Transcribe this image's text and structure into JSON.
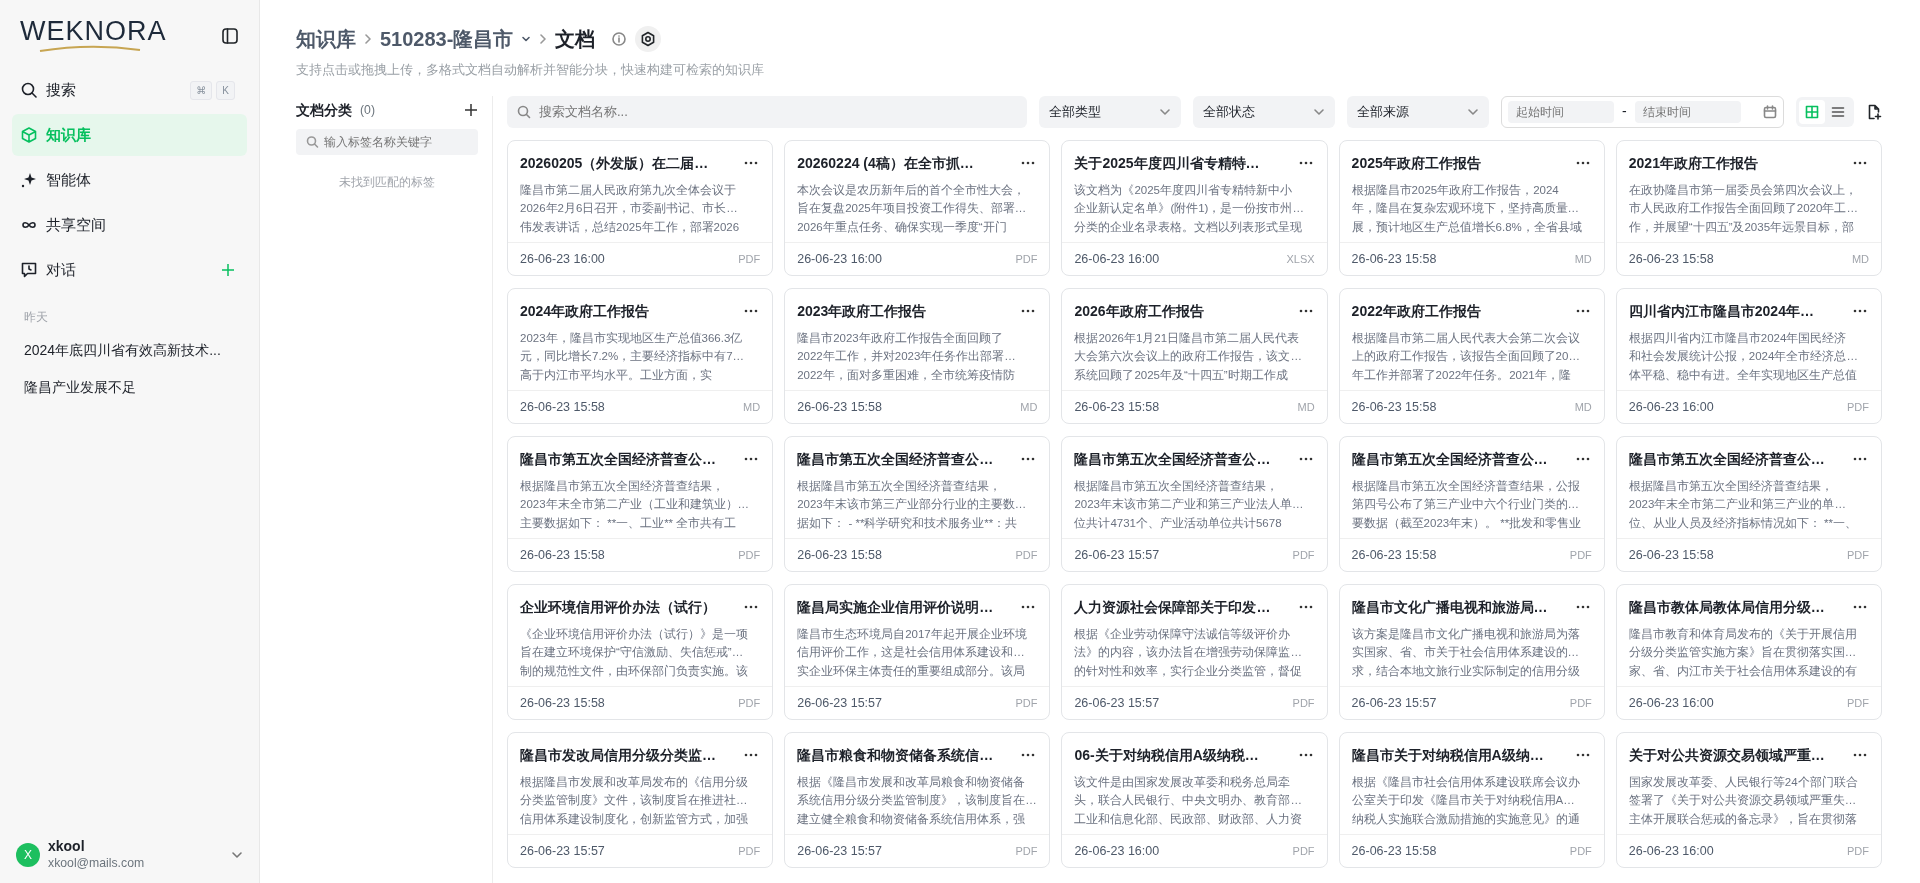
{
  "sidebar": {
    "logo": "WEKNORA",
    "nav": [
      {
        "kind": "search",
        "label": "搜索",
        "shortcut": [
          "⌘",
          "K"
        ],
        "selected": false
      },
      {
        "kind": "knowledge",
        "label": "知识库",
        "selected": true
      },
      {
        "kind": "agent",
        "label": "智能体",
        "selected": false
      },
      {
        "kind": "shared",
        "label": "共享空间",
        "selected": false
      },
      {
        "kind": "chat",
        "label": "对话",
        "selected": false
      }
    ],
    "history_group": "昨天",
    "history": [
      "2024年底四川省有效高新技术...",
      "隆昌产业发展不足"
    ],
    "user": {
      "initial": "X",
      "name": "xkool",
      "email": "xkool@mails.com"
    }
  },
  "header": {
    "breadcrumb": [
      "知识库",
      "510283-隆昌市",
      "文档"
    ],
    "subtitle": "支持点击或拖拽上传，多格式文档自动解析并智能分块，快速构建可检索的知识库"
  },
  "tags": {
    "title": "文档分类",
    "count": "(0)",
    "placeholder": "输入标签名称关键字",
    "empty": "未找到匹配的标签"
  },
  "toolbar": {
    "search_placeholder": "搜索文档名称...",
    "filters": [
      "全部类型",
      "全部状态",
      "全部来源"
    ],
    "date_start_placeholder": "起始时间",
    "date_separator": "-",
    "date_end_placeholder": "结束时间",
    "views": [
      {
        "kind": "grid",
        "selected": true
      },
      {
        "kind": "list",
        "selected": false
      }
    ]
  },
  "documents": [
    {
      "title": "20260205（外发版）在二届…",
      "summary": [
        "隆昌市第二届人民政府第九次全体会议于",
        "2026年2月6日召开，市委副书记、市长…",
        "伟发表讲话，总结2025年工作，部署2026"
      ],
      "time": "26-06-23 16:00",
      "type": "PDF"
    },
    {
      "title": "20260224 (4稿）在全市抓…",
      "summary": [
        "本次会议是农历新年后的首个全市性大会，",
        "旨在复盘2025年项目投资工作得失、部署…",
        "2026年重点任务、确保实现一季度“开门"
      ],
      "time": "26-06-23 16:00",
      "type": "PDF"
    },
    {
      "title": "关于2025年度四川省专精特…",
      "summary": [
        "该文档为《2025年度四川省专精特新中小",
        "企业新认定名单》(附件1)，是一份按市州…",
        "分类的企业名录表格。文档以列表形式呈现"
      ],
      "time": "26-06-23 16:00",
      "type": "XLSX"
    },
    {
      "title": "2025年政府工作报告",
      "summary": [
        "根据隆昌市2025年政府工作报告，2024",
        "年，隆昌在复杂宏观环境下，坚持高质量…",
        "展，预计地区生产总值增长6.8%，全省县域"
      ],
      "time": "26-06-23 15:58",
      "type": "MD"
    },
    {
      "title": "2021年政府工作报告",
      "summary": [
        "在政协隆昌市第一届委员会第四次会议上，",
        "市人民政府工作报告全面回顾了2020年工…",
        "作，并展望“十四五”及2035年远景目标，部"
      ],
      "time": "26-06-23 15:58",
      "type": "MD"
    },
    {
      "title": "2024年政府工作报告",
      "summary": [
        "2023年，隆昌市实现地区生产总值366.3亿",
        "元，同比增长7.2%，主要经济指标中有7…",
        "高于内江市平均水平。工业方面，实"
      ],
      "time": "26-06-23 15:58",
      "type": "MD"
    },
    {
      "title": "2023年政府工作报告",
      "summary": [
        "隆昌市2023年政府工作报告全面回顾了",
        "2022年工作，并对2023年任务作出部署…",
        "2022年，面对多重困难，全市统筹疫情防"
      ],
      "time": "26-06-23 15:58",
      "type": "MD"
    },
    {
      "title": "2026年政府工作报告",
      "summary": [
        "根据2026年1月21日隆昌市第二届人民代表",
        "大会第六次会议上的政府工作报告，该文…",
        "系统回顾了2025年及“十四五”时期工作成"
      ],
      "time": "26-06-23 15:58",
      "type": "MD"
    },
    {
      "title": "2022年政府工作报告",
      "summary": [
        "根据隆昌市第二届人民代表大会第二次会议",
        "上的政府工作报告，该报告全面回顾了20…",
        "年工作并部署了2022年任务。2021年，隆"
      ],
      "time": "26-06-23 15:58",
      "type": "MD"
    },
    {
      "title": "四川省内江市隆昌市2024年…",
      "summary": [
        "根据四川省内江市隆昌市2024年国民经济",
        "和社会发展统计公报，2024年全市经济总…",
        "体平稳、稳中有进。全年实现地区生产总值"
      ],
      "time": "26-06-23 16:00",
      "type": "PDF"
    },
    {
      "title": "隆昌市第五次全国经济普查公…",
      "summary": [
        "根据隆昌市第五次全国经济普查结果，",
        "2023年末全市第二产业（工业和建筑业）…",
        "主要数据如下：  **一、工业** 全市共有工"
      ],
      "time": "26-06-23 15:58",
      "type": "PDF"
    },
    {
      "title": "隆昌市第五次全国经济普查公…",
      "summary": [
        "根据隆昌市第五次全国经济普查结果，",
        "2023年末该市第三产业部分行业的主要数…",
        "据如下：  - **科学研究和技术服务业**：共"
      ],
      "time": "26-06-23 15:58",
      "type": "PDF"
    },
    {
      "title": "隆昌市第五次全国经济普查公…",
      "summary": [
        "根据隆昌市第五次全国经济普查结果，",
        "2023年末该市第二产业和第三产业法人单…",
        "位共计4731个、产业活动单位共计5678"
      ],
      "time": "26-06-23 15:57",
      "type": "PDF"
    },
    {
      "title": "隆昌市第五次全国经济普查公…",
      "summary": [
        "根据隆昌市第五次全国经济普查结果，公报",
        "第四号公布了第三产业中六个行业门类的…",
        "要数据（截至2023年末）。 **批发和零售业"
      ],
      "time": "26-06-23 15:58",
      "type": "PDF"
    },
    {
      "title": "隆昌市第五次全国经济普查公…",
      "summary": [
        "根据隆昌市第五次全国经济普查结果，",
        "2023年末全市第二产业和第三产业的单…",
        "位、从业人员及经济指标情况如下：  **一、"
      ],
      "time": "26-06-23 15:58",
      "type": "PDF"
    },
    {
      "title": "企业环境信用评价办法（试行）",
      "summary": [
        "《企业环境信用评价办法（试行）》是一项",
        "旨在建立环境保护“守信激励、失信惩戒”…",
        "制的规范性文件，由环保部门负责实施。该"
      ],
      "time": "26-06-23 15:58",
      "type": "PDF"
    },
    {
      "title": "隆昌局实施企业信用评价说明…",
      "summary": [
        "隆昌市生态环境局自2017年起开展企业环境",
        "信用评价工作，这是社会信用体系建设和…",
        "实企业环保主体责任的重要组成部分。该局"
      ],
      "time": "26-06-23 15:57",
      "type": "PDF"
    },
    {
      "title": "人力资源社会保障部关于印发…",
      "summary": [
        "根据《企业劳动保障守法诚信等级评价办",
        "法》的内容，该办法旨在增强劳动保障监…",
        "的针对性和效率，实行企业分类监管，督促"
      ],
      "time": "26-06-23 15:57",
      "type": "PDF"
    },
    {
      "title": "隆昌市文化广播电视和旅游局…",
      "summary": [
        "该方案是隆昌市文化广播电视和旅游局为落",
        "实国家、省、市关于社会信用体系建设的…",
        "求，结合本地文旅行业实际制定的信用分级"
      ],
      "time": "26-06-23 15:57",
      "type": "PDF"
    },
    {
      "title": "隆昌市教体局教体局信用分级…",
      "summary": [
        "隆昌市教育和体育局发布的《关于开展信用",
        "分级分类监管实施方案》旨在贯彻落实国…",
        "家、省、内江市关于社会信用体系建设的有"
      ],
      "time": "26-06-23 16:00",
      "type": "PDF"
    },
    {
      "title": "隆昌市发改局信用分级分类监…",
      "summary": [
        "根据隆昌市发展和改革局发布的《信用分级",
        "分类监管制度》文件，该制度旨在推进社…",
        "信用体系建设制度化，创新监管方式，加强"
      ],
      "time": "26-06-23 15:57",
      "type": "PDF"
    },
    {
      "title": "隆昌市粮食和物资储备系统信…",
      "summary": [
        "根据《隆昌市发展和改革局粮食和物资储备",
        "系统信用分级分类监管制度》，该制度旨在…",
        "建立健全粮食和物资储备系统信用体系，强"
      ],
      "time": "26-06-23 15:57",
      "type": "PDF"
    },
    {
      "title": "06-关于对纳税信用A级纳税…",
      "summary": [
        "该文件是由国家发展改革委和税务总局牵",
        "头，联合人民银行、中央文明办、教育部…",
        "工业和信息化部、民政部、财政部、人力资"
      ],
      "time": "26-06-23 16:00",
      "type": "PDF"
    },
    {
      "title": "隆昌市关于对纳税信用A级纳…",
      "summary": [
        "根据《隆昌市社会信用体系建设联席会议办",
        "公室关于印发《隆昌市关于对纳税信用A…",
        "纳税人实施联合激励措施的实施意见》的通"
      ],
      "time": "26-06-23 15:58",
      "type": "PDF"
    },
    {
      "title": "关于对公共资源交易领域严重…",
      "summary": [
        "国家发展改革委、人民银行等24个部门联合",
        "签署了《关于对公共资源交易领域严重失…",
        "主体开展联合惩戒的备忘录》，旨在贯彻落"
      ],
      "time": "26-06-23 16:00",
      "type": "PDF"
    }
  ]
}
